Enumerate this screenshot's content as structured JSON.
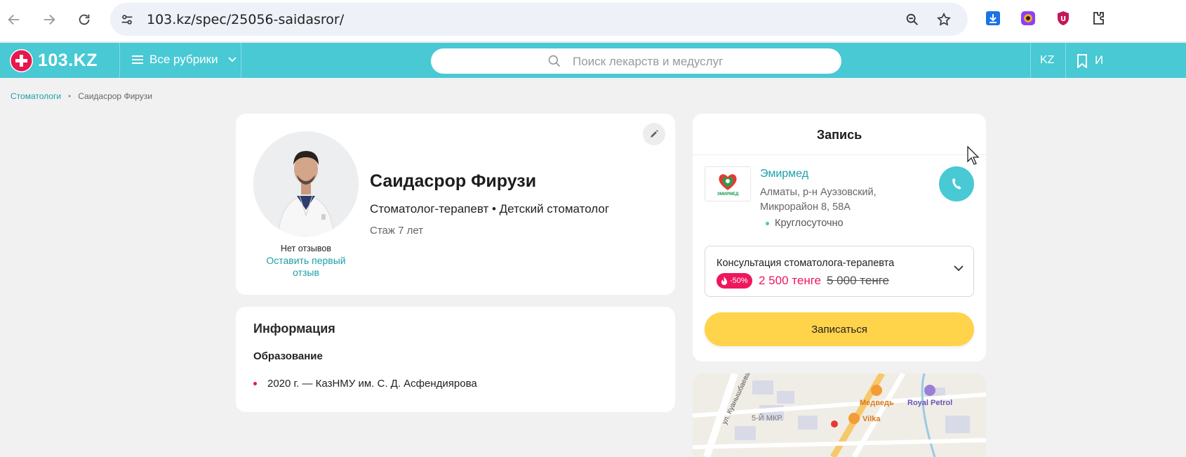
{
  "browser": {
    "url": "103.kz/spec/25056-saidasror/",
    "icons": [
      "back-icon",
      "forward-icon",
      "reload-icon",
      "site-info-icon",
      "zoom-icon",
      "star-icon",
      "download-icon",
      "extension-icon"
    ]
  },
  "header": {
    "logo_text": "103.KZ",
    "rubrics_label": "Все рубрики",
    "search_placeholder": "Поиск лекарств и медуслуг",
    "lang": "KZ",
    "brand_color": "#48c9d4"
  },
  "breadcrumb": {
    "parent": "Стоматологи",
    "current": "Саидасрор Фирузи"
  },
  "doctor": {
    "name": "Саидасрор Фирузи",
    "specialties": "Стоматолог-терапевт • Детский стоматолог",
    "experience": "Стаж 7 лет",
    "reviews": "Нет отзывов",
    "leave_review": "Оставить первый отзыв"
  },
  "info": {
    "title": "Информация",
    "education_title": "Образование",
    "education_items": [
      "2020 г. — КазНМУ им. С. Д. Асфендиярова"
    ]
  },
  "booking": {
    "title": "Запись",
    "clinic_name": "Эмирмед",
    "clinic_logo_text": "ЭМИРМЕД",
    "clinic_address": "Алматы, р-н Ауэзовский, Микрорайон 8, 58А",
    "clinic_hours": "Круглосуточно",
    "service_name": "Консультация стоматолога-терапевта",
    "discount": "-50%",
    "price_new": "2 500 тенге",
    "price_old": "5 000 тенге",
    "book_button": "Записаться",
    "accent_color": "#f0165e",
    "button_color": "#ffd34a"
  },
  "map": {
    "labels": [
      "Медведь",
      "Royal Petrol",
      "ул. Куанышбаева",
      "5-Й МКР.",
      "Vilka"
    ]
  }
}
